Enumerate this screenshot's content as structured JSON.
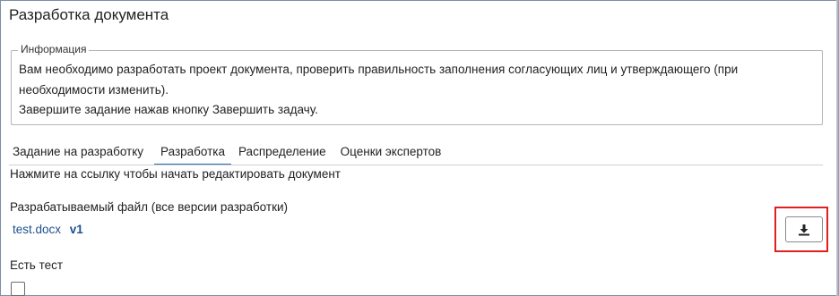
{
  "window": {
    "title": "Разработка документа"
  },
  "info": {
    "legend": "Информация",
    "line1": "Вам необходимо разработать проект документа, проверить правильность заполнения согласующих лиц и утверждающего (при",
    "line2": "необходимости изменить).",
    "line3": "Завершите задание нажав кнопку Завершить задачу."
  },
  "tabs": [
    {
      "label": "Задание на разработку",
      "active": false
    },
    {
      "label": "Разработка",
      "active": true
    },
    {
      "label": "Распределение",
      "active": false
    },
    {
      "label": "Оценки экспертов",
      "active": false
    }
  ],
  "main": {
    "hint": "Нажмите на ссылку чтобы начать редактировать документ",
    "file_label": "Разрабатываемый файл (все версии разработки)",
    "file_name": "test.docx",
    "file_version": "v1",
    "download_icon": "download-icon",
    "test_label": "Есть тест",
    "test_checked": false
  },
  "colors": {
    "active_tab_underline": "#2c6fb8",
    "link": "#1f4f8f",
    "highlight": "#e02020"
  }
}
